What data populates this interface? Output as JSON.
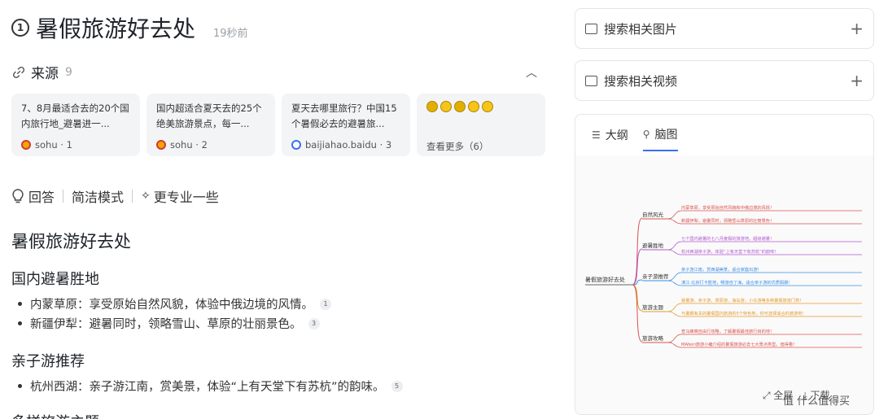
{
  "query": {
    "title": "暑假旅游好去处",
    "time": "19秒前"
  },
  "sources": {
    "label": "来源",
    "count": "9",
    "cards": [
      {
        "title": "7、8月最适合去的20个国内旅行地_避暑进一...",
        "site": "sohu · 1"
      },
      {
        "title": "国内超适合夏天去的25个绝美旅游景点，每一...",
        "site": "sohu · 2"
      },
      {
        "title": "夏天去哪里旅行？中国15个暑假必去的避暑旅...",
        "site": "baijiahao.baidu · 3"
      }
    ],
    "more_label": "查看更多（6）"
  },
  "answer_bar": {
    "answer": "回答",
    "concise": "简洁模式",
    "pro": "更专业一些"
  },
  "article": {
    "heading": "暑假旅游好去处",
    "sections": [
      {
        "title": "国内避暑胜地",
        "items": [
          {
            "text": "内蒙草原：享受原始自然风貌，体验中俄边境的风情。",
            "ref": "1"
          },
          {
            "text": "新疆伊犁：避暑同时，领略雪山、草原的壮丽景色。",
            "ref": "3"
          }
        ]
      },
      {
        "title": "亲子游推荐",
        "items": [
          {
            "text": "杭州西湖：亲子游江南，赏美景，体验“上有天堂下有苏杭”的韵味。",
            "ref": "5"
          }
        ]
      },
      {
        "title": "多样旅游主题",
        "items": []
      }
    ]
  },
  "right": {
    "images_label": "搜索相关图片",
    "videos_label": "搜索相关视频",
    "tab_outline": "大纲",
    "tab_mindmap": "脑图",
    "mindmap": {
      "root": "暑假旅游好去处",
      "branches": [
        {
          "label": "自然风光",
          "color": "#d9534f",
          "leaves": [
            "内蒙草原，享受原始自然风貌和中俄边境的风情！",
            "新疆伊犁，避暑同时，领略雪山草原的壮丽景色！"
          ]
        },
        {
          "label": "避暑胜地",
          "color": "#b05ad0",
          "leaves": [
            "七个国内避暑的七八月度假的旅游地，超级避暑！",
            "杭州西湖亲子游，体验“上有天堂下有苏杭”的韵味！"
          ]
        },
        {
          "label": "亲子游推荐",
          "color": "#3a8ee6",
          "leaves": [
            "亲子游江南，赏西湖美景，适合家庭出游！",
            "漓江·北京打卡胜地，畅游自了海，适合亲子游的优质假期！"
          ]
        },
        {
          "label": "旅游主题",
          "color": "#e59a2d",
          "leaves": [
            "避暑游、亲子游、草原游、海岛游，小众游等多种暑假旅游门类！",
            "与暑期有关的暑假国内旅游的5个特色地，你可选择适合的旅游地！"
          ]
        },
        {
          "label": "旅游攻略",
          "color": "#d9534f",
          "leaves": [
            "查马蜂窝自由行攻略，了解暑假最佳旅行目的地！",
            "MAfeiri旅游小编介绍的暑假旅游必去七大景点类型，值得看！"
          ]
        }
      ],
      "tools": [
        "全屏",
        "下载"
      ]
    },
    "watermark": "值 什么值得买"
  }
}
